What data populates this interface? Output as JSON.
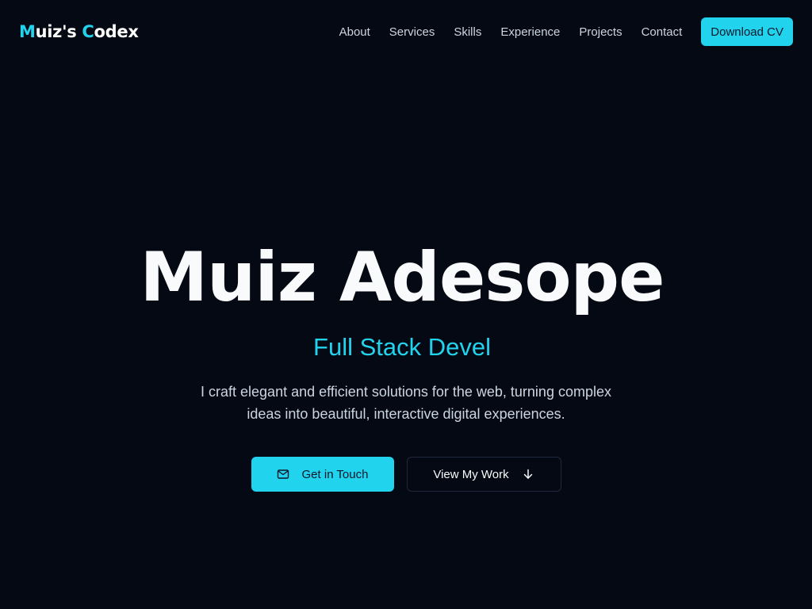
{
  "header": {
    "logo": {
      "part1_accent": "M",
      "part1_rest": "uiz's ",
      "part2_accent": "C",
      "part2_rest": "odex"
    },
    "nav": [
      {
        "label": "About"
      },
      {
        "label": "Services"
      },
      {
        "label": "Skills"
      },
      {
        "label": "Experience"
      },
      {
        "label": "Projects"
      },
      {
        "label": "Contact"
      }
    ],
    "cv_button": "Download CV"
  },
  "hero": {
    "name": "Muiz Adesope",
    "role": "Full Stack Devel",
    "description": "I craft elegant and efficient solutions for the web, turning complex ideas into beautiful, interactive digital experiences.",
    "primary_button": {
      "label": "Get in Touch",
      "icon": "mail-icon"
    },
    "secondary_button": {
      "label": "View My Work",
      "icon": "arrow-down-icon"
    }
  },
  "colors": {
    "background": "#050914",
    "accent": "#22d3ee",
    "text": "#f8fafc",
    "muted": "#cbd5e1"
  }
}
